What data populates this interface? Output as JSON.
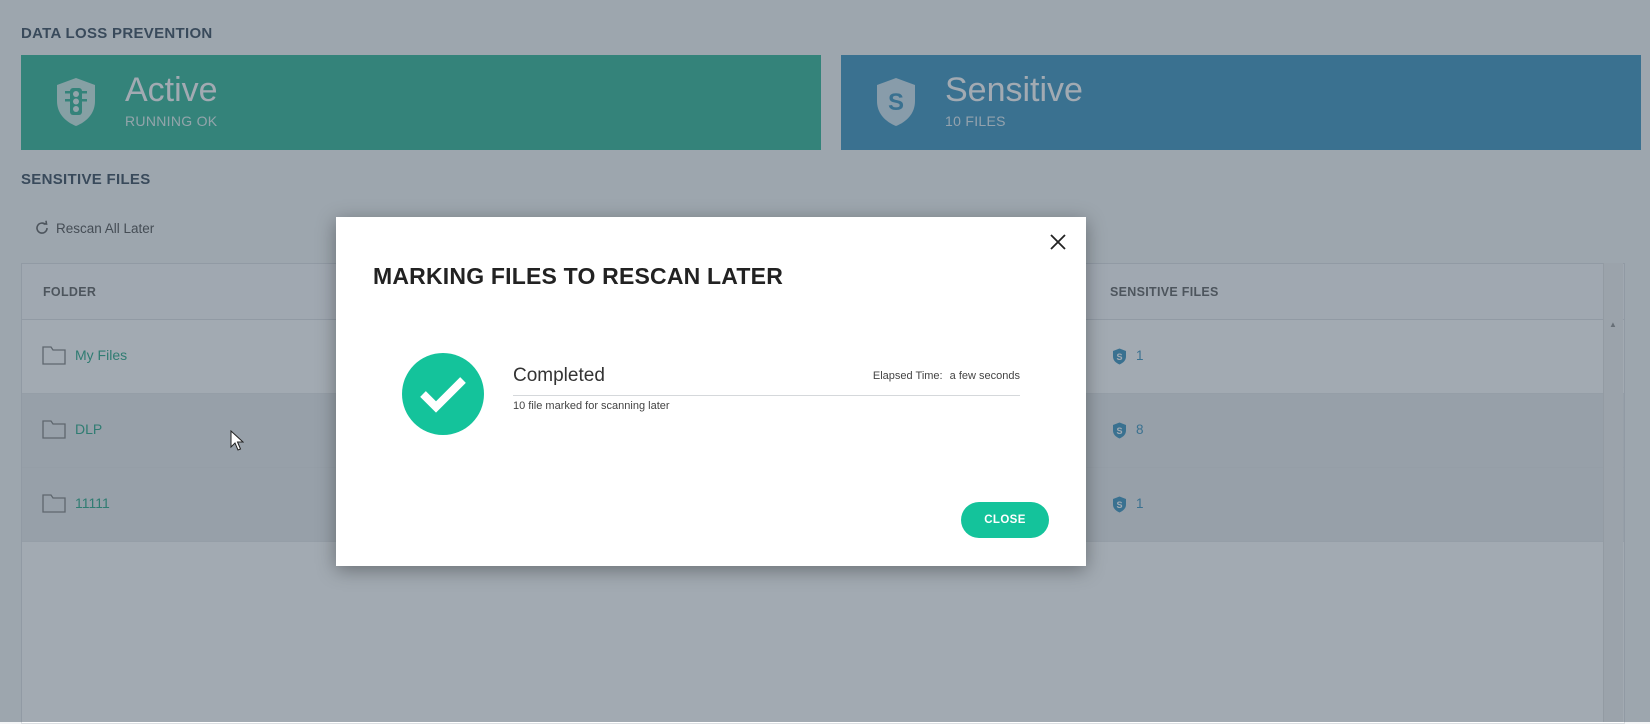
{
  "section": {
    "dlp_title": "DATA LOSS PREVENTION",
    "sensitive_files_title": "SENSITIVE FILES"
  },
  "cards": {
    "active": {
      "big": "Active",
      "small": "RUNNING OK",
      "color": "#23b08f",
      "icon": "traffic-light-shield-icon"
    },
    "sensitive": {
      "big": "Sensitive",
      "small": "10 FILES",
      "color": "#2f8dbb",
      "icon": "dollar-shield-icon"
    }
  },
  "toolbar": {
    "rescan_label": "Rescan All Later"
  },
  "table": {
    "columns": {
      "folder": "FOLDER",
      "sensitive": "SENSITIVE FILES"
    },
    "rows": [
      {
        "name": "My Files",
        "count": "1"
      },
      {
        "name": "DLP",
        "count": "8"
      },
      {
        "name": "11111",
        "count": "1"
      }
    ]
  },
  "modal": {
    "title": "MARKING FILES TO RESCAN LATER",
    "status": "Completed",
    "elapsed_label": "Elapsed Time:",
    "elapsed_value": "a few seconds",
    "message": "10 file marked for scanning later",
    "close_label": "CLOSE",
    "accent": "#14c39b"
  }
}
